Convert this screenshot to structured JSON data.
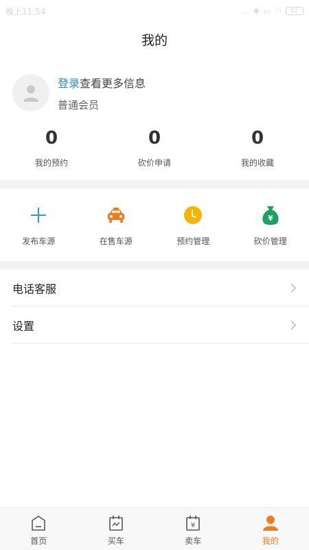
{
  "status": {
    "time": "晚上11:54",
    "indicators": "...",
    "battery": "62"
  },
  "header": {
    "title": "我的"
  },
  "profile": {
    "login_link": "登录",
    "login_suffix": "查看更多信息",
    "member_level": "普通会员"
  },
  "stats": [
    {
      "value": "0",
      "label": "我的预约"
    },
    {
      "value": "0",
      "label": "砍价申请"
    },
    {
      "value": "0",
      "label": "我的收藏"
    }
  ],
  "quick_actions": [
    {
      "label": "发布车源",
      "icon": "plus-icon",
      "color": "#2a9fd6"
    },
    {
      "label": "在售车源",
      "icon": "taxi-icon",
      "color": "#f07c22"
    },
    {
      "label": "预约管理",
      "icon": "clock-icon",
      "color": "#f5b400"
    },
    {
      "label": "砍价管理",
      "icon": "money-bag-icon",
      "color": "#1aa260"
    }
  ],
  "menu": [
    {
      "label": "电话客服"
    },
    {
      "label": "设置"
    }
  ],
  "tabs": [
    {
      "label": "首页",
      "icon": "home-icon",
      "active": false
    },
    {
      "label": "买车",
      "icon": "buy-car-icon",
      "active": false
    },
    {
      "label": "卖车",
      "icon": "sell-car-icon",
      "active": false
    },
    {
      "label": "我的",
      "icon": "profile-icon",
      "active": true
    }
  ],
  "colors": {
    "accent": "#f07c22",
    "link": "#2a8ad8"
  }
}
